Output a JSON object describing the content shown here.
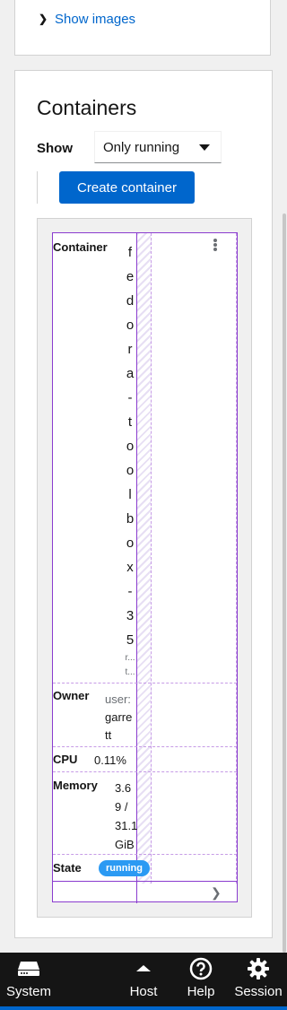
{
  "images": {
    "show_images_label": "Show images"
  },
  "containers": {
    "title": "Containers",
    "show_label": "Show",
    "filter_selected": "Only running",
    "create_button_label": "Create container",
    "row": {
      "container_label": "Container",
      "name_chars": [
        "f",
        "e",
        "d",
        "o",
        "r",
        "a",
        "-",
        "t",
        "o",
        "o",
        "l",
        "b",
        "o",
        "x",
        "-",
        "3",
        "5"
      ],
      "image_chars": [
        "r...",
        "t..."
      ],
      "owner_label": "Owner",
      "owner_prefix": "user:",
      "owner_name_lines": [
        "garre",
        "tt"
      ],
      "cpu_label": "CPU",
      "cpu_value": "0.11%",
      "memory_label": "Memory",
      "memory_lines": [
        "3.6",
        "9 /",
        "31.1",
        "GiB"
      ],
      "state_label": "State",
      "state_value": "running"
    }
  },
  "nav": {
    "system": "System",
    "host": "Host",
    "help": "Help",
    "session": "Session"
  },
  "colors": {
    "accent": "#0066cc",
    "badge": "#2b9af3",
    "nav_bg": "#151515"
  }
}
